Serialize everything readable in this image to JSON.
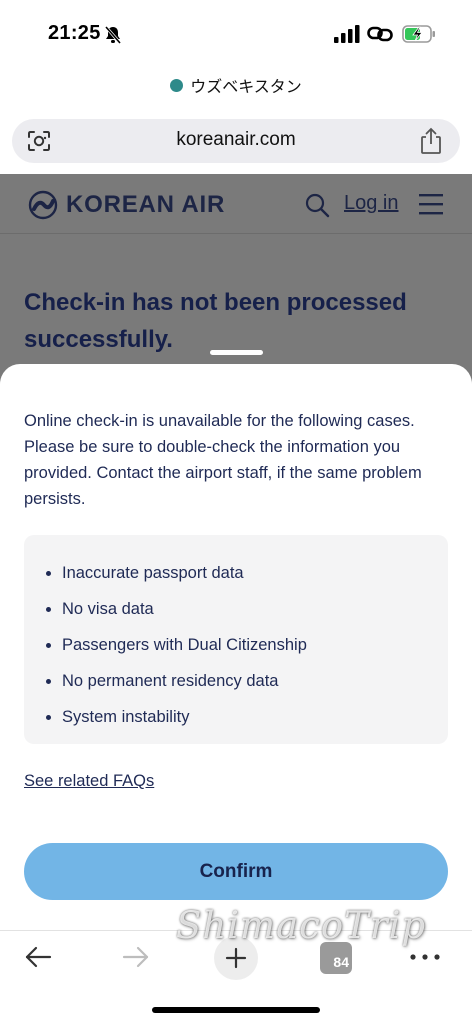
{
  "status_bar": {
    "time": "21:25"
  },
  "browser": {
    "site_name": "ウズベキスタン",
    "url": "koreanair.com",
    "tabs_count": "84"
  },
  "page": {
    "brand": "KOREAN AIR",
    "login_label": "Log in",
    "heading": "Check-in has not been processed successfully."
  },
  "sheet": {
    "message": "Online check-in is unavailable for the following cases. Please be sure to double-check the information you provided. Contact the airport staff, if the same problem persists.",
    "reasons": [
      "Inaccurate passport data",
      "No visa data",
      "Passengers with Dual Citizenship",
      "No permanent residency data",
      "System instability"
    ],
    "faq_link": "See related FAQs",
    "confirm_label": "Confirm"
  },
  "watermark": "ShimacoTrip",
  "colors": {
    "brand_navy": "#1d2545",
    "confirm_button": "#72b5e6",
    "site_dot": "#2e8a8a",
    "battery_charging": "#34c759"
  }
}
